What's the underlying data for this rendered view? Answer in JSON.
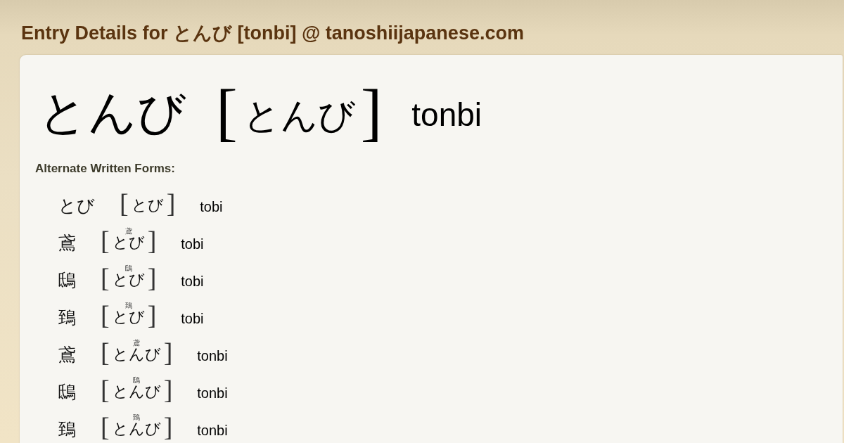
{
  "page_title": "Entry Details for とんび [tonbi] @ tanoshiijapanese.com",
  "entry": {
    "written": "とんび",
    "bracket_open": "[",
    "reading": "とんび",
    "bracket_close": "]",
    "romaji": "tonbi"
  },
  "alternate_forms": {
    "heading": "Alternate Written Forms:",
    "items": [
      {
        "written": "とび",
        "bracket_open": "[",
        "reading": "とび",
        "bracket_close": "]",
        "romaji": "tobi"
      },
      {
        "written": "鳶",
        "bracket_open": "[",
        "annotation": "鳶",
        "reading": "とび",
        "bracket_close": "]",
        "romaji": "tobi"
      },
      {
        "written": "鴟",
        "bracket_open": "[",
        "annotation": "鴟",
        "reading": "とび",
        "bracket_close": "]",
        "romaji": "tobi"
      },
      {
        "written": "鵄",
        "bracket_open": "[",
        "annotation": "鵄",
        "reading": "とび",
        "bracket_close": "]",
        "romaji": "tobi"
      },
      {
        "written": "鳶",
        "bracket_open": "[",
        "annotation": "鳶",
        "reading": "とんび",
        "bracket_close": "]",
        "romaji": "tonbi"
      },
      {
        "written": "鴟",
        "bracket_open": "[",
        "annotation": "鴟",
        "reading": "とんび",
        "bracket_close": "]",
        "romaji": "tonbi"
      },
      {
        "written": "鵄",
        "bracket_open": "[",
        "annotation": "鵄",
        "reading": "とんび",
        "bracket_close": "]",
        "romaji": "tonbi"
      }
    ]
  }
}
